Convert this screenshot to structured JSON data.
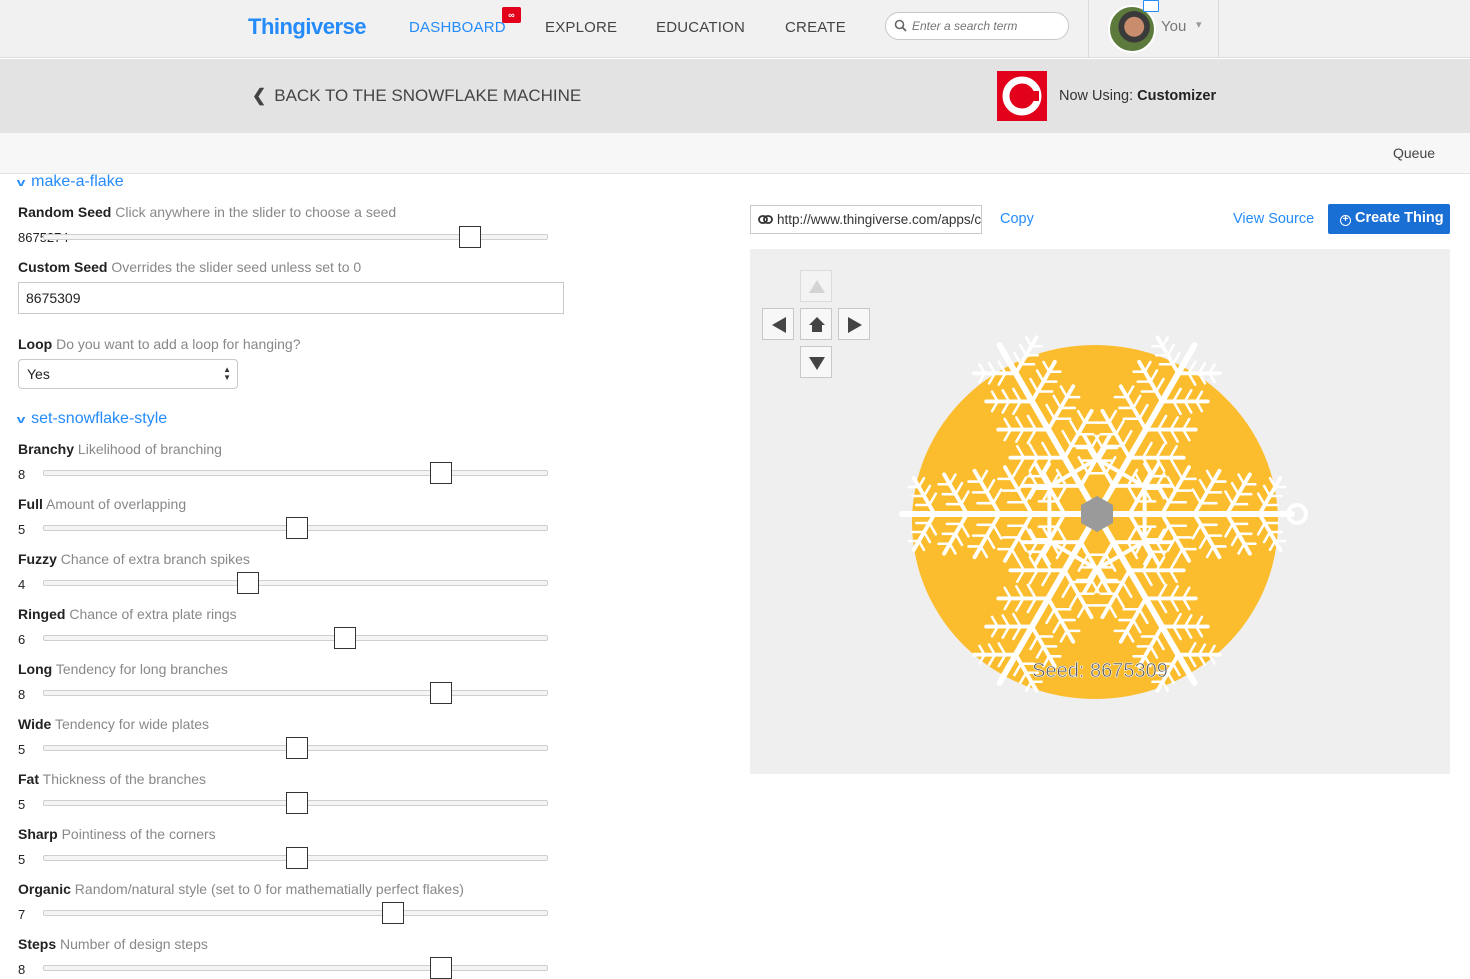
{
  "nav": {
    "logo": "Thingiverse",
    "items": [
      {
        "label": "DASHBOARD",
        "active": true,
        "badge": "∞"
      },
      {
        "label": "EXPLORE"
      },
      {
        "label": "EDUCATION"
      },
      {
        "label": "CREATE"
      }
    ],
    "search_placeholder": "Enter a search term",
    "user_label": "You"
  },
  "subheader": {
    "back_label": "BACK TO THE SNOWFLAKE MACHINE",
    "now_using_prefix": "Now Using:",
    "now_using_app": "Customizer"
  },
  "queue_label": "Queue",
  "sections": {
    "make_a_flake": "make-a-flake",
    "set_snowflake_style": "set-snowflake-style"
  },
  "params": {
    "random_seed": {
      "name": "Random Seed",
      "desc": "Click anywhere in the slider to choose a seed",
      "value": "8675274",
      "fraction": 0.86
    },
    "custom_seed": {
      "name": "Custom Seed",
      "desc": "Overrides the slider seed unless set to 0",
      "value": "8675309"
    },
    "loop": {
      "name": "Loop",
      "desc": "Do you want to add a loop for hanging?",
      "value": "Yes"
    },
    "branchy": {
      "name": "Branchy",
      "desc": "Likelihood of branching",
      "value": "8",
      "fraction": 0.8
    },
    "full": {
      "name": "Full",
      "desc": "Amount of overlapping",
      "value": "5",
      "fraction": 0.5
    },
    "fuzzy": {
      "name": "Fuzzy",
      "desc": "Chance of extra branch spikes",
      "value": "4",
      "fraction": 0.4
    },
    "ringed": {
      "name": "Ringed",
      "desc": "Chance of extra plate rings",
      "value": "6",
      "fraction": 0.6
    },
    "long": {
      "name": "Long",
      "desc": "Tendency for long branches",
      "value": "8",
      "fraction": 0.8
    },
    "wide": {
      "name": "Wide",
      "desc": "Tendency for wide plates",
      "value": "5",
      "fraction": 0.5
    },
    "fat": {
      "name": "Fat",
      "desc": "Thickness of the branches",
      "value": "5",
      "fraction": 0.5
    },
    "sharp": {
      "name": "Sharp",
      "desc": "Pointiness of the corners",
      "value": "5",
      "fraction": 0.5
    },
    "organic": {
      "name": "Organic",
      "desc": "Random/natural style (set to 0 for mathematially perfect flakes)",
      "value": "7",
      "fraction": 0.7
    },
    "steps": {
      "name": "Steps",
      "desc": "Number of design steps",
      "value": "8",
      "fraction": 0.8
    }
  },
  "share": {
    "url": "http://www.thingiverse.com/apps/customizer/run?thing_id=",
    "copy_label": "Copy",
    "view_source_label": "View Source",
    "create_label": "Create Thing"
  },
  "preview": {
    "seed_text": "Seed: 8675309",
    "plate_color": "#fbbd2e",
    "flake_color": "#ffffff",
    "hub_color": "#9a9a9a"
  }
}
